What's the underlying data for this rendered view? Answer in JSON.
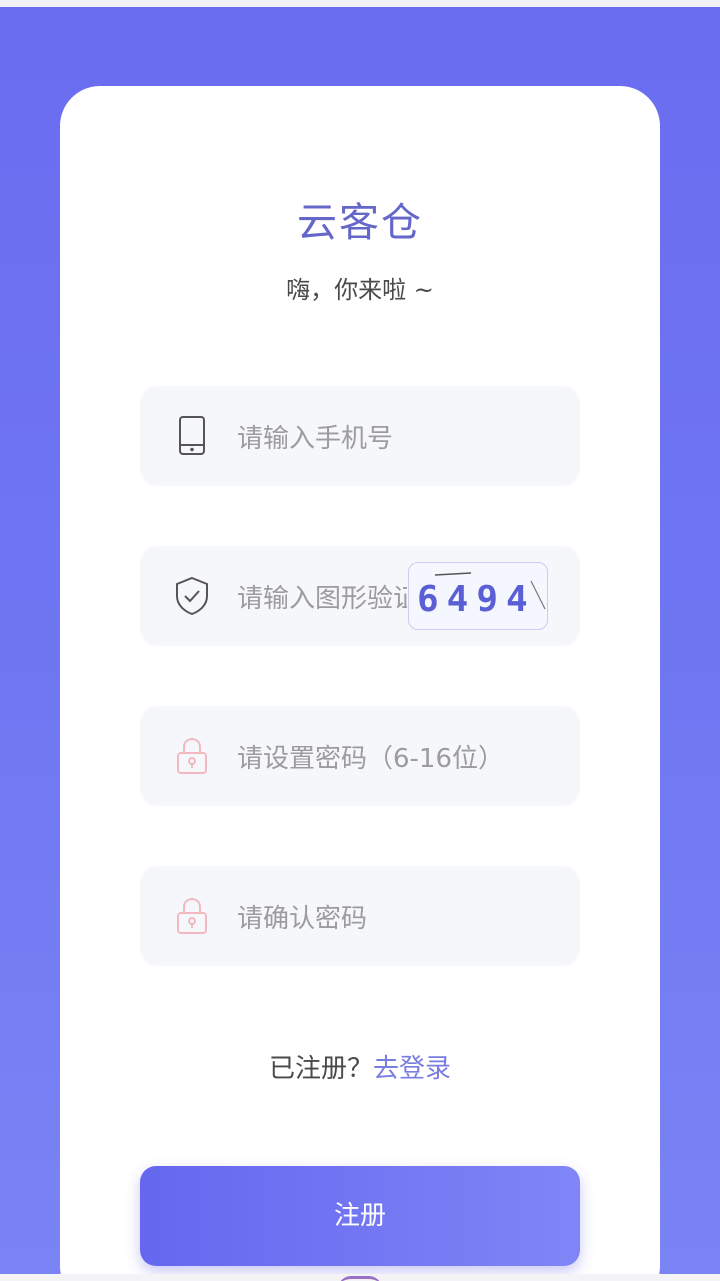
{
  "app": {
    "title": "云客仓",
    "subtitle": "嗨，你来啦 ~"
  },
  "form": {
    "phone_placeholder": "请输入手机号",
    "captcha_placeholder": "请输入图形验证码",
    "captcha_code": "6494",
    "password_placeholder": "请设置密码（6-16位）",
    "confirm_placeholder": "请确认密码"
  },
  "login_prompt": {
    "text": "已注册？",
    "link": "去登录"
  },
  "register_button": "注册",
  "colors": {
    "brand": "#6466c9",
    "background": "#6a6cf0",
    "button": "#6567ef",
    "link": "#7a7de0",
    "lock_icon": "#f3b7c0",
    "captcha_text": "#5b5fd6"
  },
  "icons": {
    "phone": "phone-icon",
    "captcha": "shield-check-icon",
    "password": "lock-icon",
    "confirm": "lock-icon"
  }
}
